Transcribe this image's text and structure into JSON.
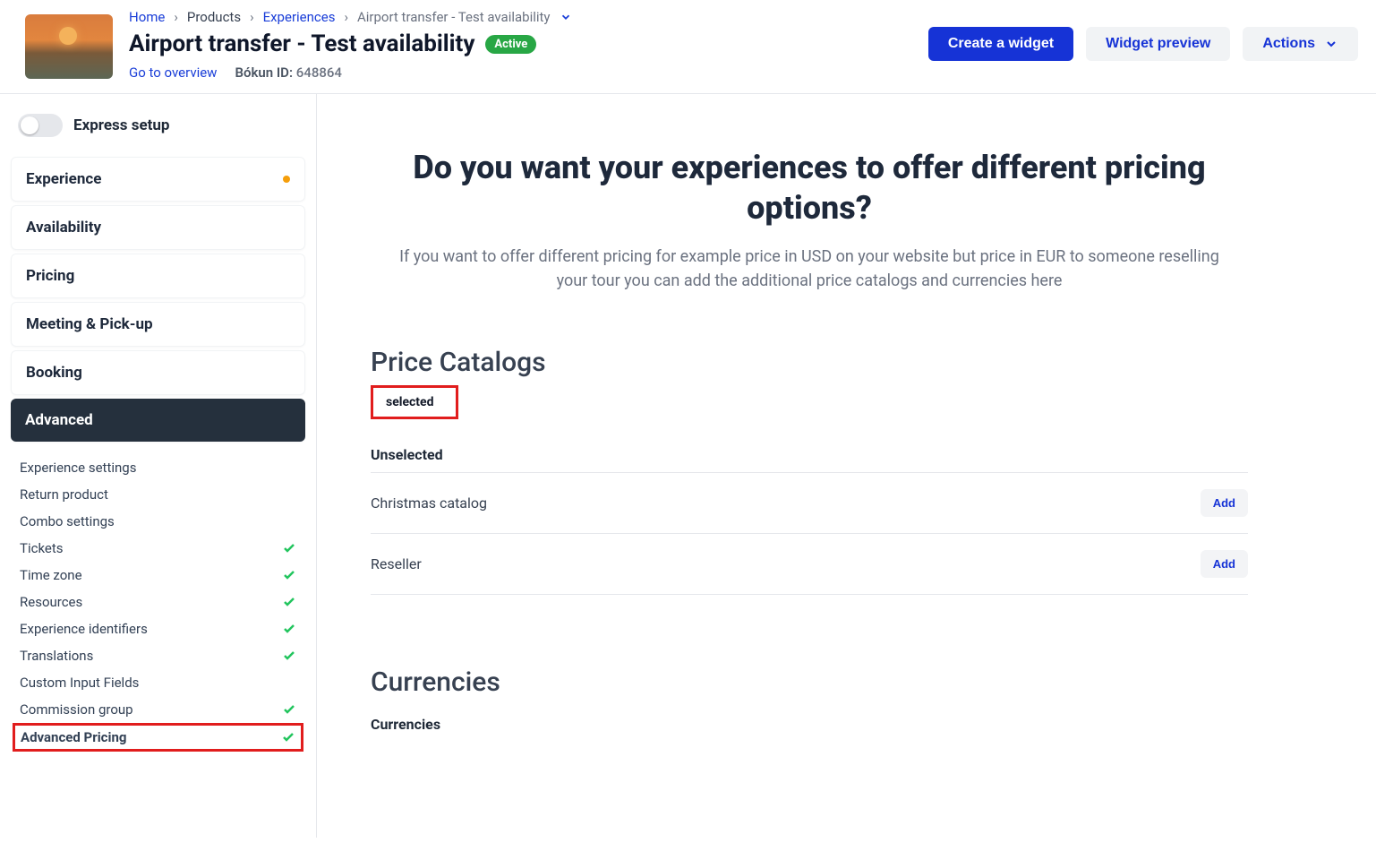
{
  "breadcrumbs": {
    "home": "Home",
    "products": "Products",
    "experiences": "Experiences",
    "current": "Airport transfer - Test availability"
  },
  "page_title": "Airport transfer - Test availability",
  "status_badge": "Active",
  "overview_link": "Go to overview",
  "bokun_label": "Bókun ID:",
  "bokun_id": "648864",
  "actions": {
    "create_widget": "Create a widget",
    "widget_preview": "Widget preview",
    "actions": "Actions"
  },
  "express_setup_label": "Express setup",
  "nav": {
    "experience": "Experience",
    "availability": "Availability",
    "pricing": "Pricing",
    "meeting": "Meeting & Pick-up",
    "booking": "Booking",
    "advanced": "Advanced"
  },
  "sub_nav": {
    "exp_settings": "Experience settings",
    "return_product": "Return product",
    "combo": "Combo settings",
    "tickets": "Tickets",
    "timezone": "Time zone",
    "resources": "Resources",
    "identifiers": "Experience identifiers",
    "translations": "Translations",
    "custom_fields": "Custom Input Fields",
    "commission": "Commission group",
    "adv_pricing": "Advanced Pricing"
  },
  "main": {
    "heading": "Do you want your experiences to offer different pricing options?",
    "subtitle": "If you want to offer different pricing for example price in USD on your website but price in EUR to someone reselling your tour you can add the additional price catalogs and currencies here",
    "price_catalogs_h": "Price Catalogs",
    "selected_label": "selected",
    "unselected_label": "Unselected",
    "catalogs": [
      {
        "name": "Christmas catalog",
        "action": "Add"
      },
      {
        "name": "Reseller",
        "action": "Add"
      }
    ],
    "currencies_h": "Currencies",
    "currencies_label": "Currencies"
  }
}
